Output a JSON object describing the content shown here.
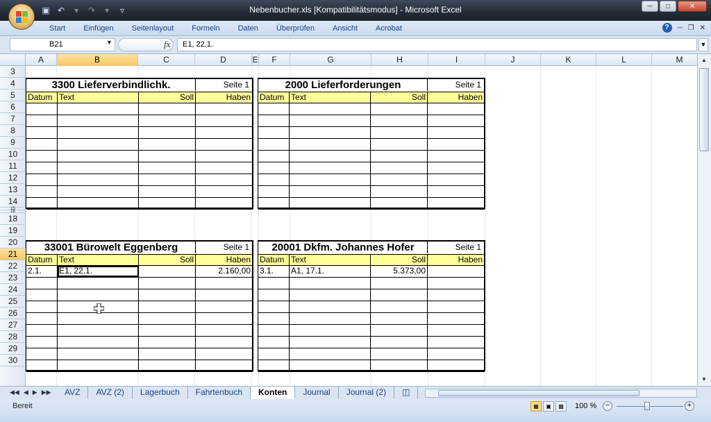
{
  "window": {
    "title": "Nebenbucher.xls  [Kompatibilitätsmodus] - Microsoft Excel",
    "accent_color": "#1b222c"
  },
  "ribbon": {
    "tabs": [
      "Start",
      "Einfügen",
      "Seitenlayout",
      "Formeln",
      "Daten",
      "Überprüfen",
      "Ansicht",
      "Acrobat"
    ]
  },
  "formula_bar": {
    "name_box": "B21",
    "fx_label": "fx",
    "formula": "E1, 22.1."
  },
  "grid": {
    "columns": [
      "A",
      "B",
      "C",
      "D",
      "E",
      "F",
      "G",
      "H",
      "I",
      "J",
      "K",
      "L",
      "M"
    ],
    "selected_column": "B",
    "rows": [
      "3",
      "4",
      "5",
      "6",
      "7",
      "8",
      "9",
      "10",
      "11",
      "12",
      "13",
      "14",
      "15",
      "16",
      "18",
      "19",
      "20",
      "21",
      "22",
      "23",
      "24",
      "25",
      "26",
      "27",
      "28",
      "29",
      "30"
    ],
    "selected_row": "21"
  },
  "accounts": [
    {
      "title": "3300 Lieferverbindlichk.",
      "page": "Seite 1",
      "headers": [
        "Datum",
        "Text",
        "Soll",
        "Haben"
      ],
      "rows": [
        [
          "",
          "",
          "",
          ""
        ],
        [
          "",
          "",
          "",
          ""
        ],
        [
          "",
          "",
          "",
          ""
        ],
        [
          "",
          "",
          "",
          ""
        ],
        [
          "",
          "",
          "",
          ""
        ],
        [
          "",
          "",
          "",
          ""
        ],
        [
          "",
          "",
          "",
          ""
        ],
        [
          "",
          "",
          "",
          ""
        ],
        [
          "",
          "",
          "",
          ""
        ]
      ]
    },
    {
      "title": "2000 Lieferforderungen",
      "page": "Seite 1",
      "headers": [
        "Datum",
        "Text",
        "Soll",
        "Haben"
      ],
      "rows": [
        [
          "",
          "",
          "",
          ""
        ],
        [
          "",
          "",
          "",
          ""
        ],
        [
          "",
          "",
          "",
          ""
        ],
        [
          "",
          "",
          "",
          ""
        ],
        [
          "",
          "",
          "",
          ""
        ],
        [
          "",
          "",
          "",
          ""
        ],
        [
          "",
          "",
          "",
          ""
        ],
        [
          "",
          "",
          "",
          ""
        ],
        [
          "",
          "",
          "",
          ""
        ]
      ]
    },
    {
      "title": "33001 Bürowelt Eggenberg",
      "page": "Seite 1",
      "headers": [
        "Datum",
        "Text",
        "Soll",
        "Haben"
      ],
      "rows": [
        [
          "2.1.",
          "E1, 22.1.",
          "",
          "2.160,00"
        ],
        [
          "",
          "",
          "",
          ""
        ],
        [
          "",
          "",
          "",
          ""
        ],
        [
          "",
          "",
          "",
          ""
        ],
        [
          "",
          "",
          "",
          ""
        ],
        [
          "",
          "",
          "",
          ""
        ],
        [
          "",
          "",
          "",
          ""
        ],
        [
          "",
          "",
          "",
          ""
        ],
        [
          "",
          "",
          "",
          ""
        ]
      ]
    },
    {
      "title": "20001 Dkfm.  Johannes Hofer",
      "page": "Seite 1",
      "headers": [
        "Datum",
        "Text",
        "Soll",
        "Haben"
      ],
      "rows": [
        [
          "3.1.",
          "A1, 17.1.",
          "5.373,00",
          ""
        ],
        [
          "",
          "",
          "",
          ""
        ],
        [
          "",
          "",
          "",
          ""
        ],
        [
          "",
          "",
          "",
          ""
        ],
        [
          "",
          "",
          "",
          ""
        ],
        [
          "",
          "",
          "",
          ""
        ],
        [
          "",
          "",
          "",
          ""
        ],
        [
          "",
          "",
          "",
          ""
        ],
        [
          "",
          "",
          "",
          ""
        ]
      ]
    }
  ],
  "sheet_tabs": [
    "AVZ",
    "AVZ (2)",
    "Lagerbuch",
    "Fahrtenbuch",
    "Konten",
    "Journal",
    "Journal (2)"
  ],
  "active_sheet": "Konten",
  "status": {
    "text": "Bereit",
    "zoom": "100 %"
  }
}
